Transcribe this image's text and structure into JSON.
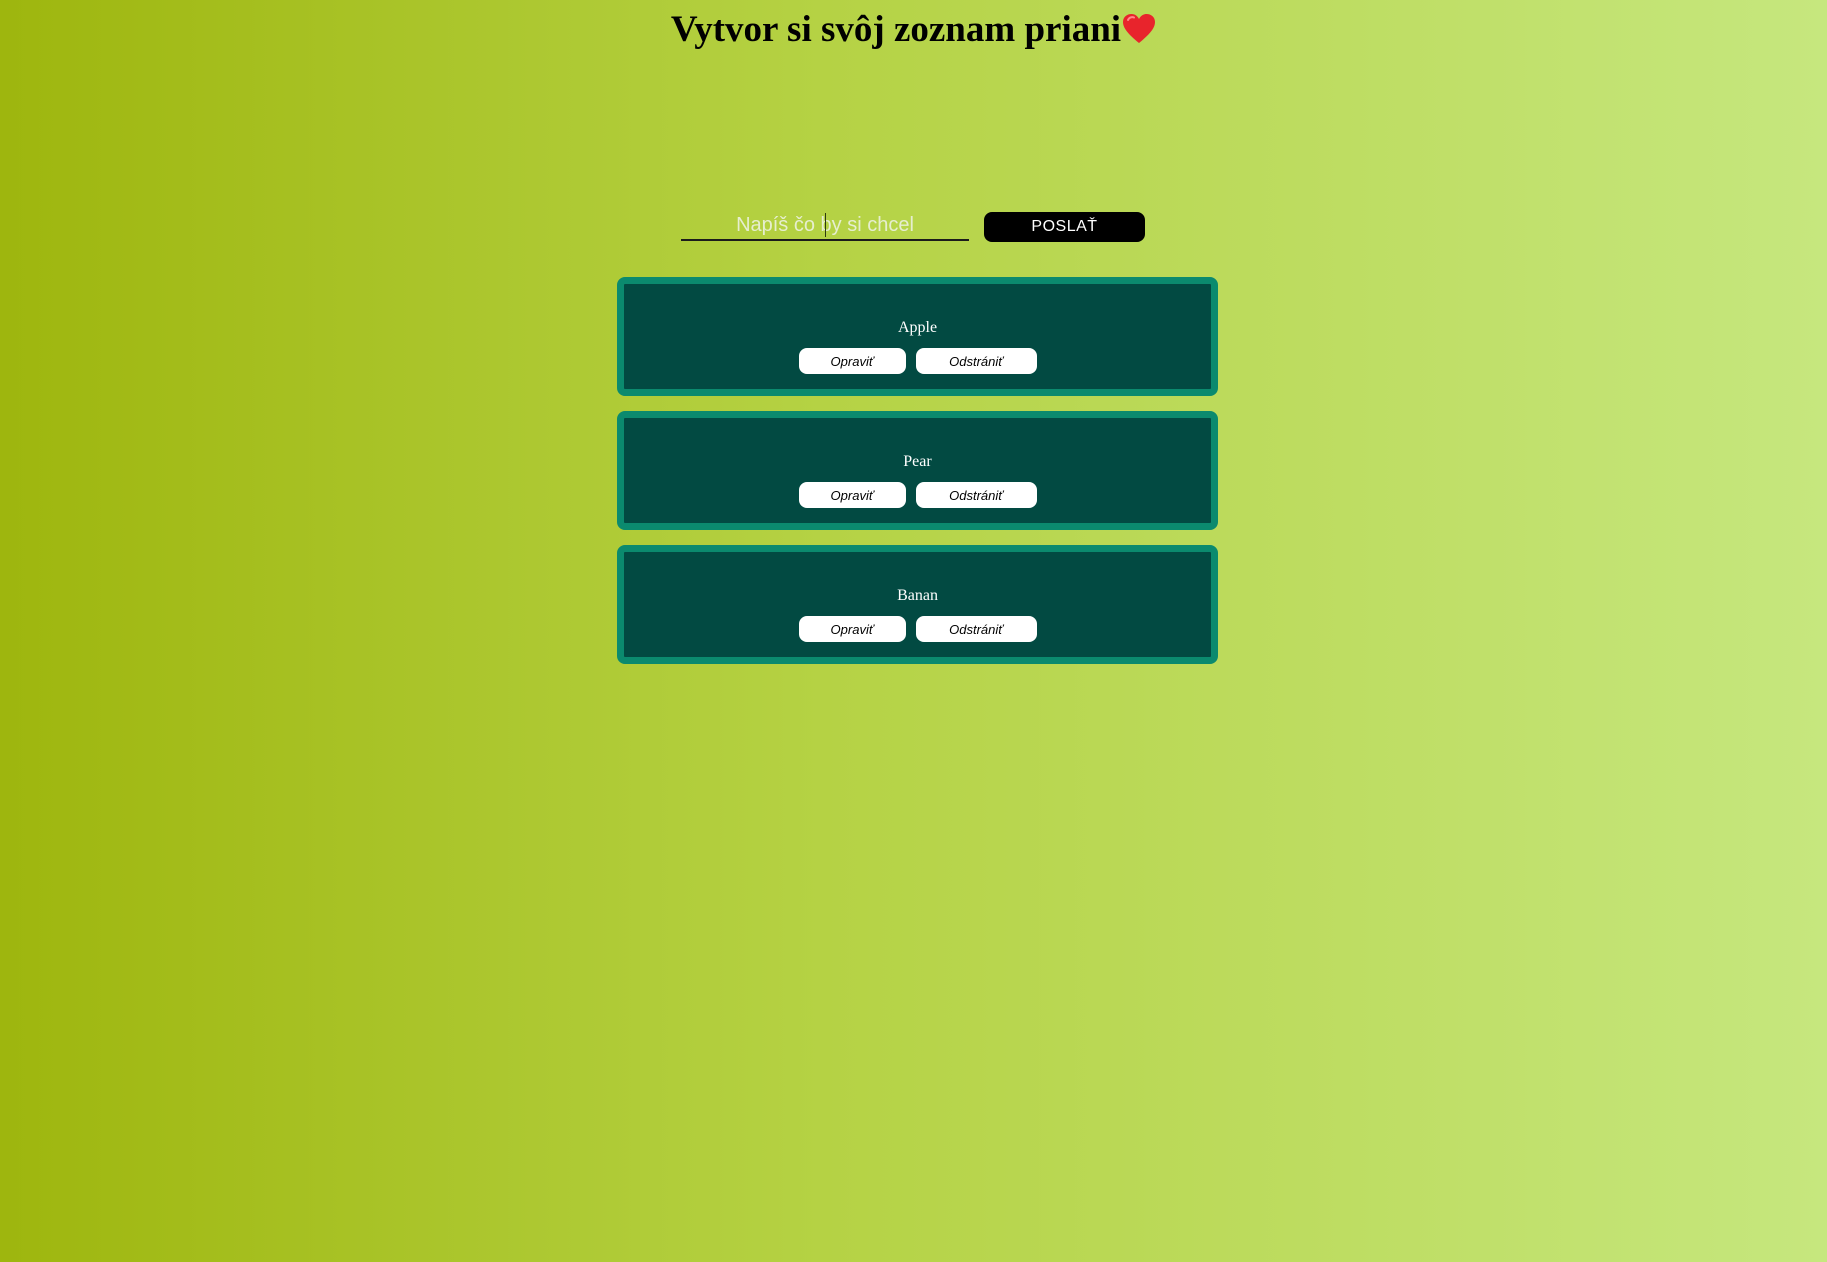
{
  "header": {
    "title": "Vytvor si svôj zoznam priani",
    "title_icon": "heart-icon"
  },
  "form": {
    "input_placeholder": "Napíš čo by si chcel",
    "input_value": "",
    "submit_label": "POSLAŤ"
  },
  "wishes": [
    {
      "label": "Apple",
      "edit_label": "Opraviť",
      "delete_label": "Odstrániť"
    },
    {
      "label": "Pear",
      "edit_label": "Opraviť",
      "delete_label": "Odstrániť"
    },
    {
      "label": "Banan",
      "edit_label": "Opraviť",
      "delete_label": "Odstrániť"
    }
  ],
  "colors": {
    "background_left": "#9eb60e",
    "background_right": "#c6e77e",
    "card_fill": "#024a42",
    "card_border": "#0b8a6e",
    "submit_button": "#000000"
  }
}
